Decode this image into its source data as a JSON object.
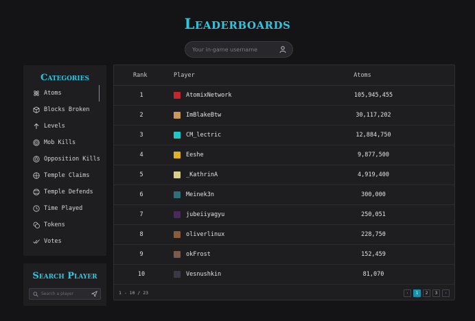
{
  "page": {
    "title": "Leaderboards"
  },
  "search": {
    "placeholder": "Your in-game username"
  },
  "categories": {
    "title": "Categories",
    "items": [
      {
        "label": "Atoms",
        "icon": "atom-icon",
        "active": true
      },
      {
        "label": "Blocks Broken",
        "icon": "cube-icon",
        "active": false
      },
      {
        "label": "Levels",
        "icon": "arrow-up-icon",
        "active": false
      },
      {
        "label": "Mob Kills",
        "icon": "target-icon",
        "active": false
      },
      {
        "label": "Opposition Kills",
        "icon": "crosshair-icon",
        "active": false
      },
      {
        "label": "Temple Claims",
        "icon": "globe-icon",
        "active": false
      },
      {
        "label": "Temple Defends",
        "icon": "shield-icon",
        "active": false
      },
      {
        "label": "Time Played",
        "icon": "clock-icon",
        "active": false
      },
      {
        "label": "Tokens",
        "icon": "coins-icon",
        "active": false
      },
      {
        "label": "Votes",
        "icon": "check-double-icon",
        "active": false
      }
    ]
  },
  "search_player": {
    "title": "Search Player",
    "placeholder": "Search a player"
  },
  "table": {
    "headers": {
      "rank": "Rank",
      "player": "Player",
      "atoms": "Atoms"
    },
    "rows": [
      {
        "rank": "1",
        "player": "AtomixNetwork",
        "atoms": "105,945,455",
        "avatar_color": "#c0282e"
      },
      {
        "rank": "2",
        "player": "ImBlakeBtw",
        "atoms": "30,117,202",
        "avatar_color": "#c89a5a"
      },
      {
        "rank": "3",
        "player": "CM_lectric",
        "atoms": "12,884,750",
        "avatar_color": "#1fc7c7"
      },
      {
        "rank": "4",
        "player": "Eeshe",
        "atoms": "9,877,500",
        "avatar_color": "#e0b020"
      },
      {
        "rank": "5",
        "player": "_KathrinA",
        "atoms": "4,919,400",
        "avatar_color": "#d8d08a"
      },
      {
        "rank": "6",
        "player": "Meinek3n",
        "atoms": "300,000",
        "avatar_color": "#2e6f7a"
      },
      {
        "rank": "7",
        "player": "jubeiiyagyu",
        "atoms": "250,051",
        "avatar_color": "#4a2a5a"
      },
      {
        "rank": "8",
        "player": "oliverlinux",
        "atoms": "228,750",
        "avatar_color": "#8a5a3a"
      },
      {
        "rank": "9",
        "player": "okFrost",
        "atoms": "152,459",
        "avatar_color": "#7a5a48"
      },
      {
        "rank": "10",
        "player": "Vesnushkin",
        "atoms": "81,070",
        "avatar_color": "#3a3a44"
      }
    ],
    "footer": {
      "range": "1 - 10 / 23"
    },
    "pagination": {
      "prev": "‹",
      "pages": [
        "1",
        "2",
        "3"
      ],
      "current": "1",
      "next": "›"
    }
  },
  "colors": {
    "accent": "#2fc6e0",
    "page_active": "#1a8fa8",
    "background": "#141416",
    "panel": "#1e1e21"
  }
}
